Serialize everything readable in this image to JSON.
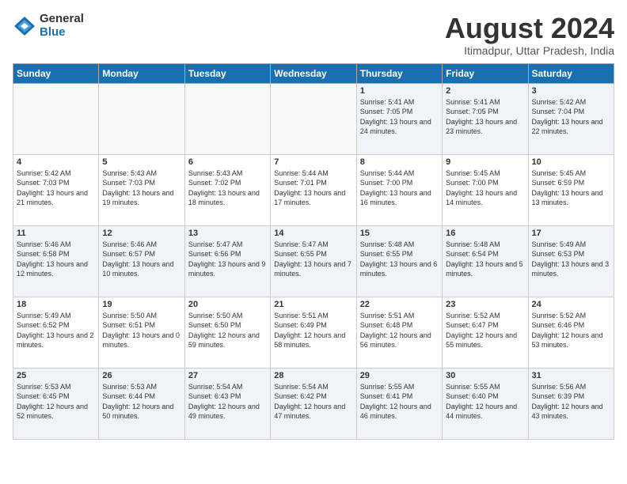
{
  "logo": {
    "general": "General",
    "blue": "Blue"
  },
  "title": {
    "main": "August 2024",
    "sub": "Itimadpur, Uttar Pradesh, India"
  },
  "weekdays": [
    "Sunday",
    "Monday",
    "Tuesday",
    "Wednesday",
    "Thursday",
    "Friday",
    "Saturday"
  ],
  "weeks": [
    [
      {
        "day": "",
        "content": ""
      },
      {
        "day": "",
        "content": ""
      },
      {
        "day": "",
        "content": ""
      },
      {
        "day": "",
        "content": ""
      },
      {
        "day": "1",
        "content": "Sunrise: 5:41 AM\nSunset: 7:05 PM\nDaylight: 13 hours\nand 24 minutes."
      },
      {
        "day": "2",
        "content": "Sunrise: 5:41 AM\nSunset: 7:05 PM\nDaylight: 13 hours\nand 23 minutes."
      },
      {
        "day": "3",
        "content": "Sunrise: 5:42 AM\nSunset: 7:04 PM\nDaylight: 13 hours\nand 22 minutes."
      }
    ],
    [
      {
        "day": "4",
        "content": "Sunrise: 5:42 AM\nSunset: 7:03 PM\nDaylight: 13 hours\nand 21 minutes."
      },
      {
        "day": "5",
        "content": "Sunrise: 5:43 AM\nSunset: 7:03 PM\nDaylight: 13 hours\nand 19 minutes."
      },
      {
        "day": "6",
        "content": "Sunrise: 5:43 AM\nSunset: 7:02 PM\nDaylight: 13 hours\nand 18 minutes."
      },
      {
        "day": "7",
        "content": "Sunrise: 5:44 AM\nSunset: 7:01 PM\nDaylight: 13 hours\nand 17 minutes."
      },
      {
        "day": "8",
        "content": "Sunrise: 5:44 AM\nSunset: 7:00 PM\nDaylight: 13 hours\nand 16 minutes."
      },
      {
        "day": "9",
        "content": "Sunrise: 5:45 AM\nSunset: 7:00 PM\nDaylight: 13 hours\nand 14 minutes."
      },
      {
        "day": "10",
        "content": "Sunrise: 5:45 AM\nSunset: 6:59 PM\nDaylight: 13 hours\nand 13 minutes."
      }
    ],
    [
      {
        "day": "11",
        "content": "Sunrise: 5:46 AM\nSunset: 6:58 PM\nDaylight: 13 hours\nand 12 minutes."
      },
      {
        "day": "12",
        "content": "Sunrise: 5:46 AM\nSunset: 6:57 PM\nDaylight: 13 hours\nand 10 minutes."
      },
      {
        "day": "13",
        "content": "Sunrise: 5:47 AM\nSunset: 6:56 PM\nDaylight: 13 hours\nand 9 minutes."
      },
      {
        "day": "14",
        "content": "Sunrise: 5:47 AM\nSunset: 6:55 PM\nDaylight: 13 hours\nand 7 minutes."
      },
      {
        "day": "15",
        "content": "Sunrise: 5:48 AM\nSunset: 6:55 PM\nDaylight: 13 hours\nand 6 minutes."
      },
      {
        "day": "16",
        "content": "Sunrise: 5:48 AM\nSunset: 6:54 PM\nDaylight: 13 hours\nand 5 minutes."
      },
      {
        "day": "17",
        "content": "Sunrise: 5:49 AM\nSunset: 6:53 PM\nDaylight: 13 hours\nand 3 minutes."
      }
    ],
    [
      {
        "day": "18",
        "content": "Sunrise: 5:49 AM\nSunset: 6:52 PM\nDaylight: 13 hours\nand 2 minutes."
      },
      {
        "day": "19",
        "content": "Sunrise: 5:50 AM\nSunset: 6:51 PM\nDaylight: 13 hours\nand 0 minutes."
      },
      {
        "day": "20",
        "content": "Sunrise: 5:50 AM\nSunset: 6:50 PM\nDaylight: 12 hours\nand 59 minutes."
      },
      {
        "day": "21",
        "content": "Sunrise: 5:51 AM\nSunset: 6:49 PM\nDaylight: 12 hours\nand 58 minutes."
      },
      {
        "day": "22",
        "content": "Sunrise: 5:51 AM\nSunset: 6:48 PM\nDaylight: 12 hours\nand 56 minutes."
      },
      {
        "day": "23",
        "content": "Sunrise: 5:52 AM\nSunset: 6:47 PM\nDaylight: 12 hours\nand 55 minutes."
      },
      {
        "day": "24",
        "content": "Sunrise: 5:52 AM\nSunset: 6:46 PM\nDaylight: 12 hours\nand 53 minutes."
      }
    ],
    [
      {
        "day": "25",
        "content": "Sunrise: 5:53 AM\nSunset: 6:45 PM\nDaylight: 12 hours\nand 52 minutes."
      },
      {
        "day": "26",
        "content": "Sunrise: 5:53 AM\nSunset: 6:44 PM\nDaylight: 12 hours\nand 50 minutes."
      },
      {
        "day": "27",
        "content": "Sunrise: 5:54 AM\nSunset: 6:43 PM\nDaylight: 12 hours\nand 49 minutes."
      },
      {
        "day": "28",
        "content": "Sunrise: 5:54 AM\nSunset: 6:42 PM\nDaylight: 12 hours\nand 47 minutes."
      },
      {
        "day": "29",
        "content": "Sunrise: 5:55 AM\nSunset: 6:41 PM\nDaylight: 12 hours\nand 46 minutes."
      },
      {
        "day": "30",
        "content": "Sunrise: 5:55 AM\nSunset: 6:40 PM\nDaylight: 12 hours\nand 44 minutes."
      },
      {
        "day": "31",
        "content": "Sunrise: 5:56 AM\nSunset: 6:39 PM\nDaylight: 12 hours\nand 43 minutes."
      }
    ]
  ]
}
